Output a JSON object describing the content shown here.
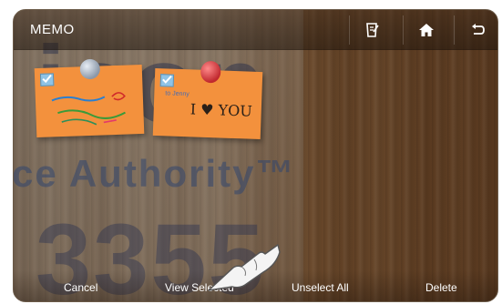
{
  "app": {
    "title": "MEMO"
  },
  "toolbar": {
    "memo_icon": "memo-edit-icon",
    "home_icon": "home-icon",
    "back_icon": "back-arrow-icon"
  },
  "watermark": {
    "line1": "icon",
    "line2": "ce Authority™",
    "line3": "3355"
  },
  "memos": [
    {
      "text": "",
      "checked": true,
      "pin_color": "#b9c3cf"
    },
    {
      "small_text": "to Jenny",
      "text": "I ♥ YOU",
      "checked": true,
      "pin_color": "#d9343a"
    }
  ],
  "actions": {
    "cancel": "Cancel",
    "view_selected": "View Selected",
    "unselect_all": "Unselect All",
    "delete": "Delete"
  },
  "colors": {
    "note": "#f3913d",
    "checkbox": "#8fc3e6"
  }
}
